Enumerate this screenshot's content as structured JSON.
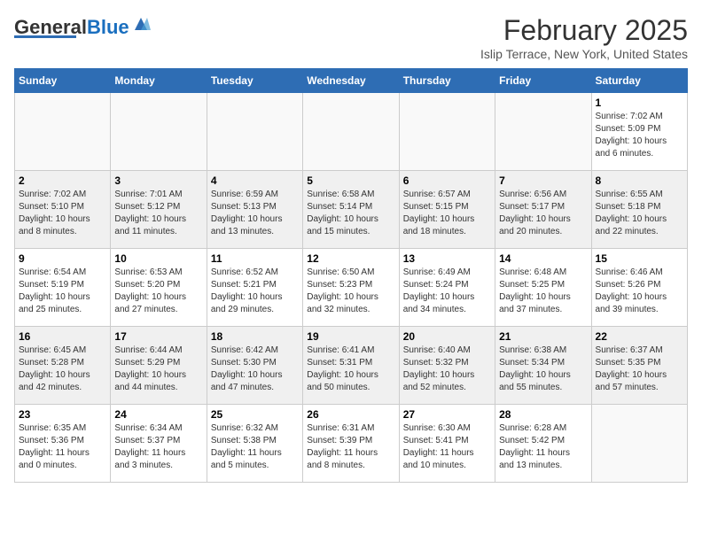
{
  "header": {
    "logo_general": "General",
    "logo_blue": "Blue",
    "month_title": "February 2025",
    "subtitle": "Islip Terrace, New York, United States"
  },
  "weekdays": [
    "Sunday",
    "Monday",
    "Tuesday",
    "Wednesday",
    "Thursday",
    "Friday",
    "Saturday"
  ],
  "weeks": [
    [
      {
        "day": "",
        "info": ""
      },
      {
        "day": "",
        "info": ""
      },
      {
        "day": "",
        "info": ""
      },
      {
        "day": "",
        "info": ""
      },
      {
        "day": "",
        "info": ""
      },
      {
        "day": "",
        "info": ""
      },
      {
        "day": "1",
        "info": "Sunrise: 7:02 AM\nSunset: 5:09 PM\nDaylight: 10 hours\nand 6 minutes."
      }
    ],
    [
      {
        "day": "2",
        "info": "Sunrise: 7:02 AM\nSunset: 5:10 PM\nDaylight: 10 hours\nand 8 minutes."
      },
      {
        "day": "3",
        "info": "Sunrise: 7:01 AM\nSunset: 5:12 PM\nDaylight: 10 hours\nand 11 minutes."
      },
      {
        "day": "4",
        "info": "Sunrise: 6:59 AM\nSunset: 5:13 PM\nDaylight: 10 hours\nand 13 minutes."
      },
      {
        "day": "5",
        "info": "Sunrise: 6:58 AM\nSunset: 5:14 PM\nDaylight: 10 hours\nand 15 minutes."
      },
      {
        "day": "6",
        "info": "Sunrise: 6:57 AM\nSunset: 5:15 PM\nDaylight: 10 hours\nand 18 minutes."
      },
      {
        "day": "7",
        "info": "Sunrise: 6:56 AM\nSunset: 5:17 PM\nDaylight: 10 hours\nand 20 minutes."
      },
      {
        "day": "8",
        "info": "Sunrise: 6:55 AM\nSunset: 5:18 PM\nDaylight: 10 hours\nand 22 minutes."
      }
    ],
    [
      {
        "day": "9",
        "info": "Sunrise: 6:54 AM\nSunset: 5:19 PM\nDaylight: 10 hours\nand 25 minutes."
      },
      {
        "day": "10",
        "info": "Sunrise: 6:53 AM\nSunset: 5:20 PM\nDaylight: 10 hours\nand 27 minutes."
      },
      {
        "day": "11",
        "info": "Sunrise: 6:52 AM\nSunset: 5:21 PM\nDaylight: 10 hours\nand 29 minutes."
      },
      {
        "day": "12",
        "info": "Sunrise: 6:50 AM\nSunset: 5:23 PM\nDaylight: 10 hours\nand 32 minutes."
      },
      {
        "day": "13",
        "info": "Sunrise: 6:49 AM\nSunset: 5:24 PM\nDaylight: 10 hours\nand 34 minutes."
      },
      {
        "day": "14",
        "info": "Sunrise: 6:48 AM\nSunset: 5:25 PM\nDaylight: 10 hours\nand 37 minutes."
      },
      {
        "day": "15",
        "info": "Sunrise: 6:46 AM\nSunset: 5:26 PM\nDaylight: 10 hours\nand 39 minutes."
      }
    ],
    [
      {
        "day": "16",
        "info": "Sunrise: 6:45 AM\nSunset: 5:28 PM\nDaylight: 10 hours\nand 42 minutes."
      },
      {
        "day": "17",
        "info": "Sunrise: 6:44 AM\nSunset: 5:29 PM\nDaylight: 10 hours\nand 44 minutes."
      },
      {
        "day": "18",
        "info": "Sunrise: 6:42 AM\nSunset: 5:30 PM\nDaylight: 10 hours\nand 47 minutes."
      },
      {
        "day": "19",
        "info": "Sunrise: 6:41 AM\nSunset: 5:31 PM\nDaylight: 10 hours\nand 50 minutes."
      },
      {
        "day": "20",
        "info": "Sunrise: 6:40 AM\nSunset: 5:32 PM\nDaylight: 10 hours\nand 52 minutes."
      },
      {
        "day": "21",
        "info": "Sunrise: 6:38 AM\nSunset: 5:34 PM\nDaylight: 10 hours\nand 55 minutes."
      },
      {
        "day": "22",
        "info": "Sunrise: 6:37 AM\nSunset: 5:35 PM\nDaylight: 10 hours\nand 57 minutes."
      }
    ],
    [
      {
        "day": "23",
        "info": "Sunrise: 6:35 AM\nSunset: 5:36 PM\nDaylight: 11 hours\nand 0 minutes."
      },
      {
        "day": "24",
        "info": "Sunrise: 6:34 AM\nSunset: 5:37 PM\nDaylight: 11 hours\nand 3 minutes."
      },
      {
        "day": "25",
        "info": "Sunrise: 6:32 AM\nSunset: 5:38 PM\nDaylight: 11 hours\nand 5 minutes."
      },
      {
        "day": "26",
        "info": "Sunrise: 6:31 AM\nSunset: 5:39 PM\nDaylight: 11 hours\nand 8 minutes."
      },
      {
        "day": "27",
        "info": "Sunrise: 6:30 AM\nSunset: 5:41 PM\nDaylight: 11 hours\nand 10 minutes."
      },
      {
        "day": "28",
        "info": "Sunrise: 6:28 AM\nSunset: 5:42 PM\nDaylight: 11 hours\nand 13 minutes."
      },
      {
        "day": "",
        "info": ""
      }
    ]
  ]
}
